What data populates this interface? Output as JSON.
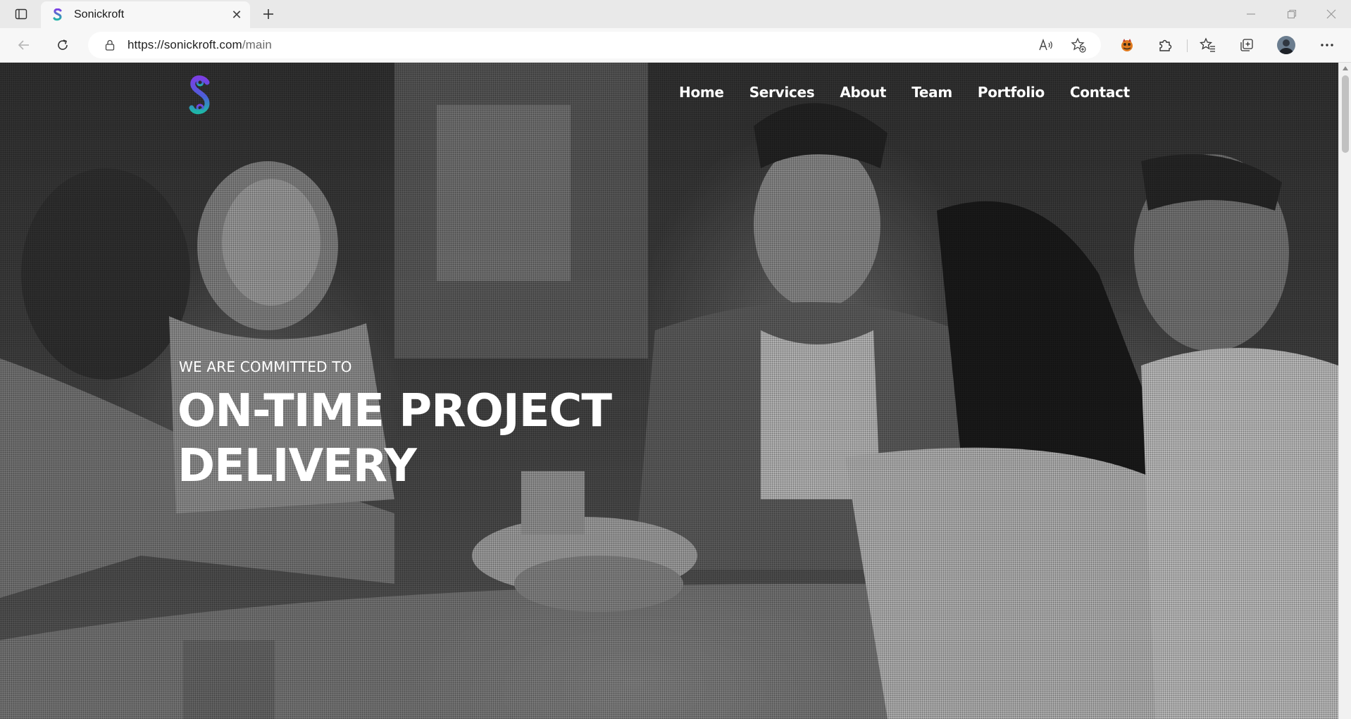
{
  "browser": {
    "tab": {
      "title": "Sonickroft",
      "close_glyph": "✕"
    },
    "url": {
      "host": "https://sonickroft.com",
      "path": "/main"
    },
    "icons": {
      "tab_actions": "tab-actions-icon",
      "new_tab": "plus-icon",
      "back": "back-arrow-icon",
      "refresh": "refresh-icon",
      "lock": "lock-icon",
      "read_aloud": "read-aloud-icon",
      "add_favorite": "add-favorite-icon",
      "extension_1": "extension-icon",
      "extensions": "puzzle-icon",
      "favorites": "favorites-icon",
      "collections": "collections-icon",
      "profile": "profile-avatar",
      "more": "more-icon",
      "minimize": "minimize-icon",
      "restore": "restore-icon",
      "close": "close-icon"
    }
  },
  "site": {
    "brand_colors": {
      "logo_top": "#7b3fe4",
      "logo_bottom": "#1fb5a8"
    },
    "nav": [
      {
        "label": "Home"
      },
      {
        "label": "Services"
      },
      {
        "label": "About"
      },
      {
        "label": "Team"
      },
      {
        "label": "Portfolio"
      },
      {
        "label": "Contact"
      }
    ],
    "hero": {
      "kicker": "WE ARE COMMITTED TO",
      "title": "ON-TIME PROJECT DELIVERY"
    }
  }
}
